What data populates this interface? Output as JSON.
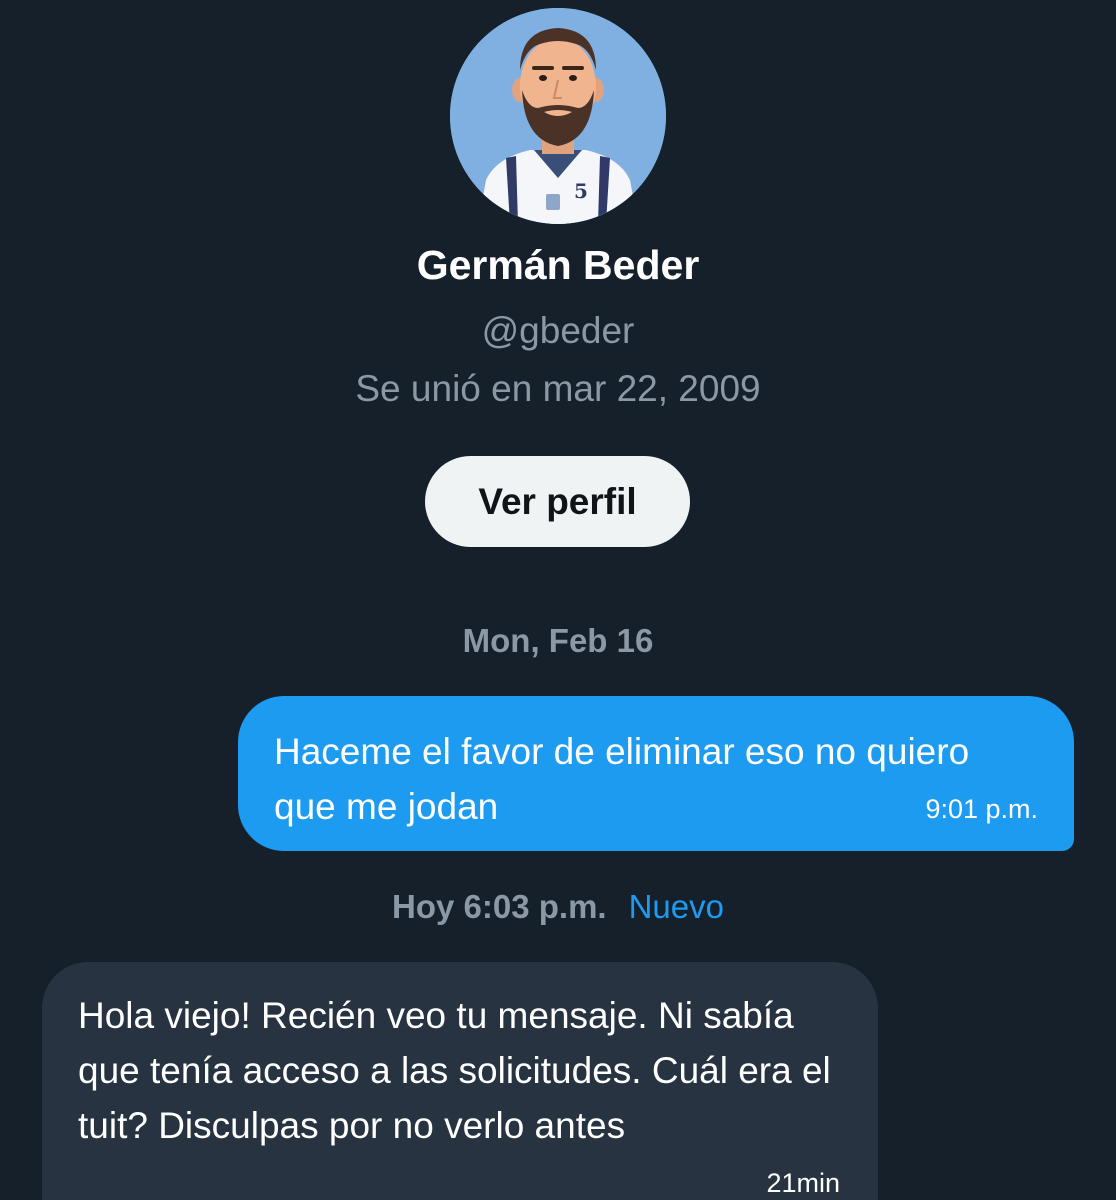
{
  "profile": {
    "display_name": "Germán Beder",
    "handle": "@gbeder",
    "joined": "Se unió en mar 22, 2009",
    "view_profile_label": "Ver perfil",
    "avatar_jersey_number": "5"
  },
  "conversation": {
    "date_separator": "Mon, Feb 16",
    "messages": [
      {
        "direction": "outgoing",
        "text": "Haceme el favor de eliminar eso no quiero que me jodan",
        "time": "9:01 p.m."
      },
      {
        "direction": "incoming",
        "text": "Hola viejo! Recién veo tu mensaje. Ni sabía que tenía acceso a las solicitudes. Cuál era el tuit? Disculpas por no verlo antes",
        "time": "21min"
      }
    ],
    "new_separator": {
      "time": "Hoy 6:03 p.m.",
      "label": "Nuevo"
    }
  },
  "colors": {
    "background": "#15202b",
    "accent": "#1d9bf0",
    "incoming_bubble": "#273340",
    "secondary_text": "#8b98a5"
  }
}
